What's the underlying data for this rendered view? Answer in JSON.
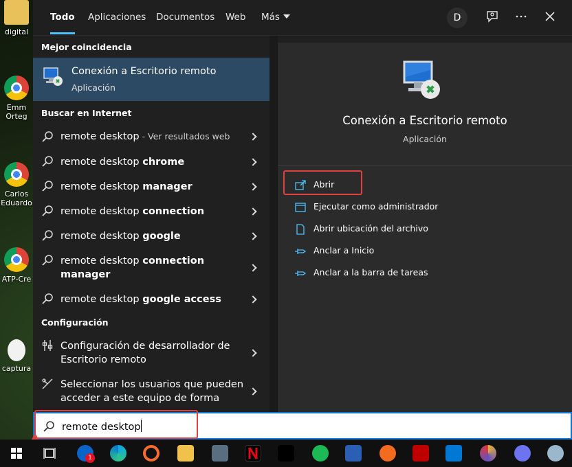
{
  "desktop": {
    "icons": [
      {
        "label": "digital",
        "kind": "folder"
      },
      {
        "label": "Emm\nOrteg",
        "kind": "chrome"
      },
      {
        "label": "Carlos\nEduardo",
        "kind": "chrome"
      },
      {
        "label": "ATP-Cre",
        "kind": "chrome"
      },
      {
        "label": "captura",
        "kind": "file"
      }
    ]
  },
  "tabs": [
    {
      "label": "Todo",
      "active": true
    },
    {
      "label": "Aplicaciones"
    },
    {
      "label": "Documentos"
    },
    {
      "label": "Web"
    },
    {
      "label": "Más"
    }
  ],
  "header": {
    "avatar": "D",
    "feedback_icon": "feedback-icon",
    "more_icon": "more-icon",
    "close_icon": "close-icon"
  },
  "left": {
    "best_match_heading": "Mejor coincidencia",
    "best_match": {
      "title": "Conexión a Escritorio remoto",
      "subtitle": "Aplicación"
    },
    "internet_heading": "Buscar en Internet",
    "internet_results": [
      {
        "prefix": "remote desktop",
        "bold": "",
        "suffix": " - Ver resultados web"
      },
      {
        "prefix": "remote desktop ",
        "bold": "chrome",
        "suffix": ""
      },
      {
        "prefix": "remote desktop ",
        "bold": "manager",
        "suffix": ""
      },
      {
        "prefix": "remote desktop ",
        "bold": "connection",
        "suffix": ""
      },
      {
        "prefix": "remote desktop ",
        "bold": "google",
        "suffix": ""
      },
      {
        "prefix": "remote desktop ",
        "bold": "connection",
        "line2": "manager",
        "suffix": ""
      },
      {
        "prefix": "remote desktop ",
        "bold": "google access",
        "suffix": ""
      }
    ],
    "config_heading": "Configuración",
    "config_results": [
      {
        "line1": "Configuración de desarrollador de",
        "line2": "Escritorio remoto"
      },
      {
        "line1": "Seleccionar los usuarios que pueden",
        "line2": "acceder a este equipo de forma"
      }
    ]
  },
  "right": {
    "title": "Conexión a Escritorio remoto",
    "subtitle": "Aplicación",
    "actions": [
      {
        "label": "Abrir",
        "icon": "open-icon"
      },
      {
        "label": "Ejecutar como administrador",
        "icon": "run-as-admin-icon"
      },
      {
        "label": "Abrir ubicación del archivo",
        "icon": "file-location-icon"
      },
      {
        "label": "Anclar a Inicio",
        "icon": "pin-icon"
      },
      {
        "label": "Anclar a la barra de tareas",
        "icon": "pin-icon"
      }
    ]
  },
  "search": {
    "value": "remote desktop"
  },
  "taskbar": {
    "mail_badge": "1",
    "apps": [
      "windows-start",
      "task-view",
      "mail",
      "edge",
      "origin",
      "file-explorer",
      "calculator",
      "netflix",
      "vpn",
      "spotify",
      "network-share",
      "brave",
      "filezilla",
      "vscode",
      "chrome-canary",
      "settings-app",
      "browser"
    ]
  },
  "colors": {
    "accent": "#4cc2ff",
    "selected": "#2c4a63",
    "highlight": "#e04040"
  }
}
